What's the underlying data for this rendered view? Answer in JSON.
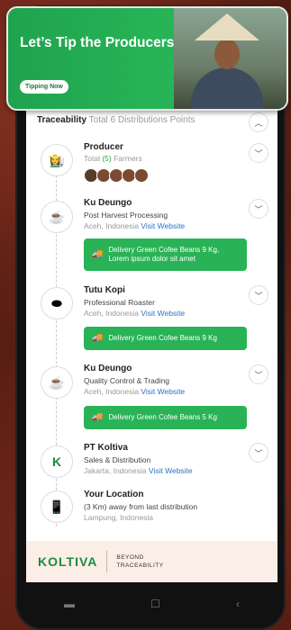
{
  "banner": {
    "title": "Let’s Tip the Producers",
    "button": "Tipping Now"
  },
  "traceability": {
    "title": "Traceability",
    "subtitle": "Total 6 Distributions Points"
  },
  "producer": {
    "name": "Producer",
    "total_prefix": "Total",
    "count": "(5)",
    "suffix": "Farmers"
  },
  "nodes": [
    {
      "name": "Ku Deungo",
      "role": "Post Harvest Processing",
      "location": "Aceh, Indonesia",
      "link": "Visit Website",
      "delivery": "Delivery Green Cofee Beans 9 Kg, Lorem ipsum dolor sit amet"
    },
    {
      "name": "Tutu Kopi",
      "role": "Professional Roaster",
      "location": "Aceh, Indonesia",
      "link": "Visit Website",
      "delivery": "Delivery Green Cofee Beans 9 Kg"
    },
    {
      "name": "Ku Deungo",
      "role": "Quality Control & Trading",
      "location": "Aceh, Indonesia",
      "link": "Visit Website",
      "delivery": "Delivery Green Cofee Beans 5 Kg"
    },
    {
      "name": "PT Koltiva",
      "role": "Sales & Distribution",
      "location": "Jakarta, Indonesia",
      "link": "Visit Website"
    }
  ],
  "location": {
    "name": "Your Location",
    "distance": "(3 Km) away from last distribution",
    "place": "Lampung, Indonesia"
  },
  "footer": {
    "logo": "KOLTIVA",
    "tagline1": "BEYOND",
    "tagline2": "TRACEABILITY"
  },
  "colors": {
    "green": "#29b356",
    "link": "#2a73c9",
    "brown": "#5a1d12"
  },
  "icons": {
    "chevron": "chevron-down-icon",
    "truck": "truck-icon"
  }
}
